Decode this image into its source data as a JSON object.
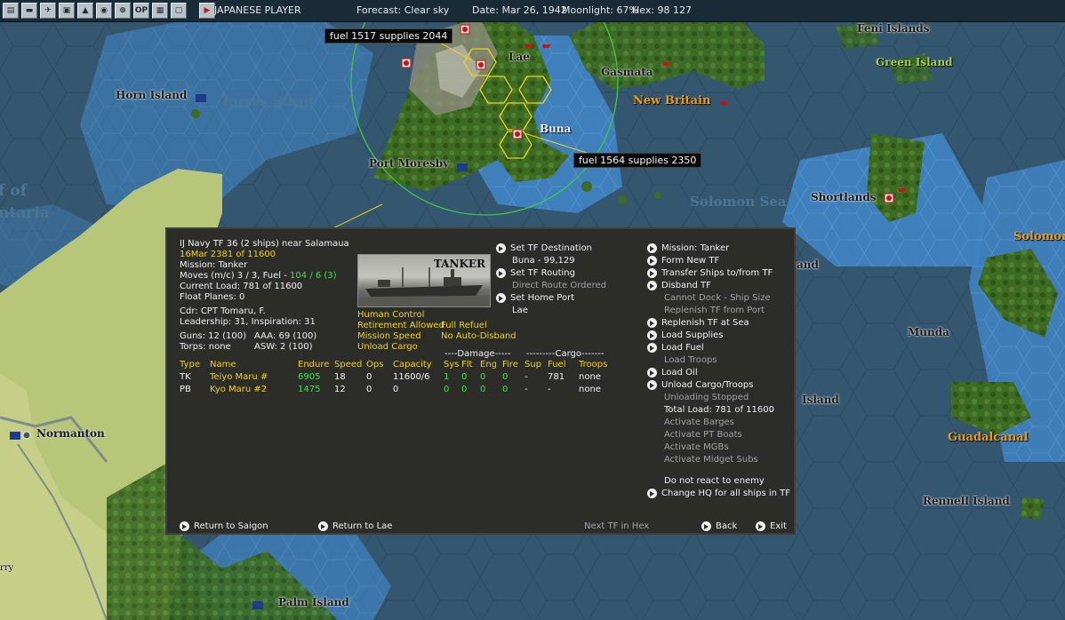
{
  "toolbar": {
    "buttons": [
      {
        "name": "map-icon",
        "glyph": "▤"
      },
      {
        "name": "ground-icon",
        "glyph": "▬"
      },
      {
        "name": "air-icon",
        "glyph": "✈"
      },
      {
        "name": "base-icon",
        "glyph": "▣"
      },
      {
        "name": "terrain-icon",
        "glyph": "▲"
      },
      {
        "name": "globe-icon",
        "glyph": "◉"
      },
      {
        "name": "grid-icon",
        "glyph": "⊕"
      },
      {
        "name": "op-icon",
        "glyph": "OP"
      },
      {
        "name": "report-icon",
        "glyph": "▦"
      },
      {
        "name": "window-icon",
        "glyph": "▢"
      },
      {
        "name": "end-turn-icon",
        "glyph": "▶"
      }
    ],
    "player": "JAPANESE PLAYER",
    "forecast": "Forecast: Clear sky",
    "date": "Date: Mar 26, 1942",
    "moonlight": "Moonlight: 67%",
    "hex": "Hex: 98 127"
  },
  "map": {
    "labels": {
      "lae": "Lae",
      "gasmata": "Gasmata",
      "new_britain": "New Britain",
      "buna": "Buna",
      "horn_island": "Horn Island",
      "torres_strait": "Torres Strait",
      "port_moresby": "Port Moresby",
      "feni_islands": "Feni Islands",
      "green_island": "Green Island",
      "shortlands": "Shortlands",
      "solomon_sea": "Solomon Sea",
      "solomon": "Solomon",
      "and": "and",
      "munda": "Munda",
      "guadalcanal": "Guadalcanal",
      "island": "Island",
      "rennell_island": "Rennell Island",
      "normanton": "Normanton",
      "palm_island": "Palm Island",
      "gulf_of": "f of",
      "carpentaria": "ntaria",
      "rry": "rry"
    },
    "callouts": {
      "lae": "fuel 1517  supplies 2044",
      "buna": "fuel 1564  supplies 2350"
    }
  },
  "panel": {
    "header": {
      "title": "IJ Navy TF 36 (2 ships) near Salamaua",
      "date_line": "16Mar 2381 of 11600",
      "mission": "Mission: Tanker",
      "moves_prefix": "Moves (m/c)  3 / 3, Fuel - ",
      "moves_fuel": "104 / 6 (3)",
      "current_load": "Current Load: 781 of 11600",
      "float_planes": "Float Planes: 0",
      "cdr": "Cdr: CPT  Tomaru, F.",
      "leadership": "Leadership: 31, Inspiration: 31",
      "guns": "Guns: 12 (100)",
      "aaa": "AAA: 69 (100)",
      "torps": "Torps: none",
      "asw": "ASW: 2 (100)"
    },
    "photo_caption": "TANKER",
    "options": {
      "human_control": "Human Control",
      "retirement": "Retirement Allowed",
      "full_refuel": "Full Refuel",
      "mission_speed": "Mission Speed",
      "no_auto_disband": "No Auto-Disband",
      "unload_cargo": "Unload Cargo"
    },
    "destination": {
      "set_dest": "Set TF Destination",
      "dest_value": "Buna - 99,129",
      "set_routing": "Set TF Routing",
      "routing_value": "Direct Route Ordered",
      "set_home": "Set Home Port",
      "home_value": "Lae"
    },
    "table": {
      "damage_header": "----Damage-----",
      "cargo_header": "---------Cargo-------",
      "columns": [
        "Type",
        "Name",
        "Endure",
        "Speed",
        "Ops",
        "Capacity",
        "Sys",
        "Flt",
        "Eng",
        "Fire",
        "Sup",
        "Fuel",
        "Troops"
      ],
      "rows": [
        {
          "type": "TK",
          "name": "Teiyo Maru #",
          "endure": "6905",
          "speed": "18",
          "ops": "0",
          "capacity": "11600/6",
          "sys": "1",
          "flt": "0",
          "eng": "0",
          "fire": "0",
          "sup": "-",
          "fuel": "781",
          "troops": "none"
        },
        {
          "type": "PB",
          "name": "Kyo Maru #2",
          "endure": "1475",
          "speed": "12",
          "ops": "0",
          "capacity": "0",
          "sys": "0",
          "flt": "0",
          "eng": "0",
          "fire": "0",
          "sup": "-",
          "fuel": "-",
          "troops": "none"
        }
      ]
    },
    "commands": {
      "mission": "Mission: Tanker",
      "form_new": "Form New TF",
      "transfer": "Transfer Ships to/from TF",
      "disband": "Disband TF",
      "cannot_dock": "Cannot Dock - Ship Size",
      "replenish_port": "Replenish TF from Port",
      "replenish_sea": "Replenish TF at Sea",
      "load_supplies": "Load Supplies",
      "load_fuel": "Load Fuel",
      "load_troops": "Load Troops",
      "load_oil": "Load Oil",
      "unload_cargo": "Unload Cargo/Troops",
      "unloading_stopped": "Unloading Stopped",
      "total_load": "Total Load: 781 of 11600",
      "activate_barges": "Activate Barges",
      "activate_pt": "Activate PT Boats",
      "activate_mgb": "Activate MGBs",
      "activate_midget": "Activate Midget Subs",
      "no_react": "Do not react to enemy",
      "change_hq": "Change HQ for all ships in TF"
    },
    "footer": {
      "return_saigon": "Return to Saigon",
      "return_lae": "Return to Lae",
      "next_tf": "Next TF in Hex",
      "back": "Back",
      "exit": "Exit"
    }
  }
}
